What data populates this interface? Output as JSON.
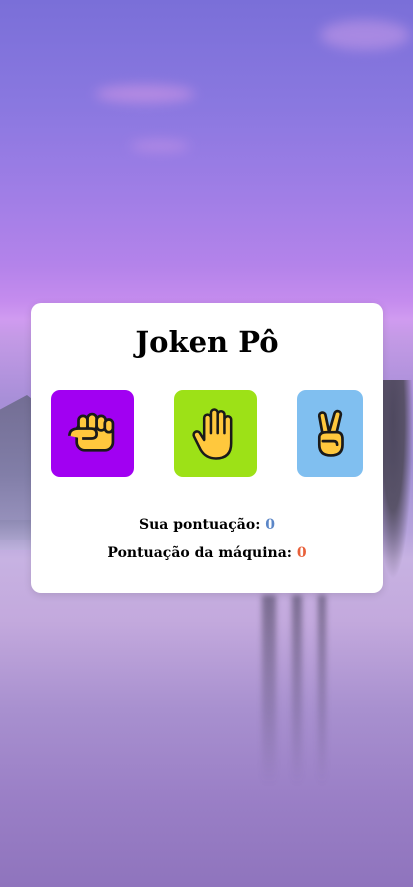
{
  "game": {
    "title": "Joken Pô",
    "choices": [
      {
        "id": "rock",
        "icon": "fist-icon",
        "color": "#a100f2"
      },
      {
        "id": "paper",
        "icon": "raised-hand-icon",
        "color": "#9de117"
      },
      {
        "id": "scissors",
        "icon": "victory-hand-icon",
        "color": "#80bff0"
      }
    ],
    "score": {
      "user_label": "Sua pontuação:",
      "user_value": "0",
      "user_color": "#5b86c7",
      "machine_label": "Pontuação da máquina:",
      "machine_value": "0",
      "machine_color": "#e8603a"
    }
  },
  "colors": {
    "card": "#ffffff",
    "emoji_yellow": "#ffc83d"
  }
}
